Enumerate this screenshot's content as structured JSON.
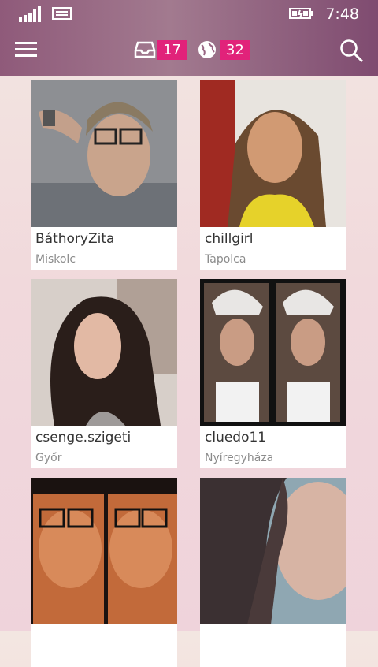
{
  "status_bar": {
    "time": "7:48",
    "signal_icon": "signal-bars-icon",
    "message_icon": "message-icon",
    "battery_icon": "battery-charging-icon"
  },
  "header": {
    "menu_icon": "hamburger-menu-icon",
    "inbox": {
      "icon": "inbox-icon",
      "count": "17"
    },
    "visits": {
      "icon": "globe-icon",
      "count": "32"
    },
    "search_icon": "search-icon",
    "accent_color": "#e1227a"
  },
  "profiles": [
    {
      "username": "BáthoryZita",
      "city": "Miskolc"
    },
    {
      "username": "chillgirl",
      "city": "Tapolca"
    },
    {
      "username": "csenge.szigeti",
      "city": "Győr"
    },
    {
      "username": "cluedo11",
      "city": "Nyíregyháza"
    },
    {
      "username": "",
      "city": ""
    },
    {
      "username": "",
      "city": ""
    }
  ]
}
